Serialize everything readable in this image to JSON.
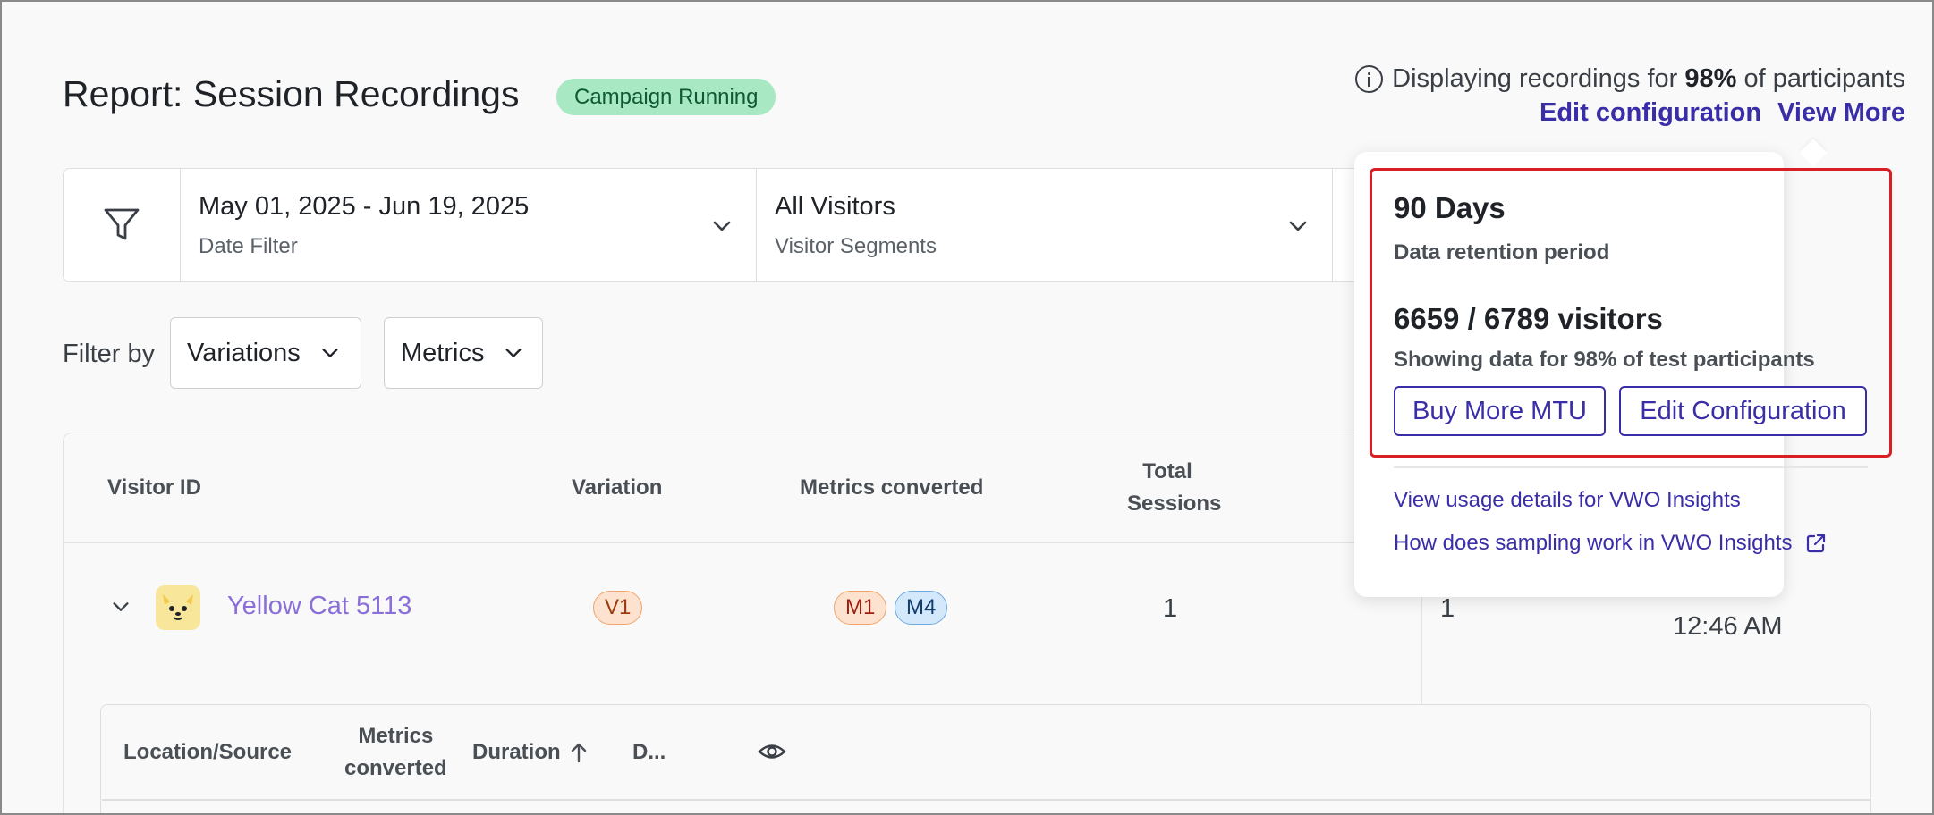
{
  "header": {
    "title": "Report: Session Recordings",
    "status_badge": "Campaign Running",
    "info_prefix": "Displaying recordings for ",
    "info_percent": "98%",
    "info_suffix": " of participants",
    "edit_link": "Edit configuration",
    "view_more_link": "View More"
  },
  "filters": {
    "date": {
      "value": "May 01, 2025 - Jun 19, 2025",
      "label": "Date Filter"
    },
    "segment": {
      "value": "All Visitors",
      "label": "Visitor Segments"
    }
  },
  "filter_by": {
    "label": "Filter by",
    "variations": "Variations",
    "metrics": "Metrics"
  },
  "table": {
    "columns": {
      "visitor_id": "Visitor ID",
      "variation": "Variation",
      "metrics_converted": "Metrics converted",
      "total_sessions_1": "Total",
      "total_sessions_2": "Sessions"
    },
    "rows": [
      {
        "visitor": "Yellow Cat 5113",
        "variation": "V1",
        "metrics": [
          "M1",
          "M4"
        ],
        "total_sessions": "1",
        "col5": "1",
        "time": "12:46 AM"
      }
    ],
    "subtable": {
      "location": "Location/Source",
      "metrics_1": "Metrics",
      "metrics_2": "converted",
      "duration": "Duration",
      "d": "D..."
    }
  },
  "popover": {
    "retention_value": "90 Days",
    "retention_label": "Data retention period",
    "visitors_value": "6659 / 6789 visitors",
    "visitors_label": "Showing data for 98% of test participants",
    "buy_button": "Buy More MTU",
    "edit_button": "Edit Configuration",
    "link_usage": "View usage details for VWO Insights",
    "link_sampling": "How does sampling work in VWO Insights"
  },
  "colors": {
    "accent": "#3a2ea8",
    "badge_bg": "#a8e9c4",
    "highlight": "#d81f26",
    "visitor_link": "#8a6fd8"
  },
  "icons": [
    "info-icon",
    "filter-icon",
    "chevron-down-icon",
    "cat-avatar-icon",
    "arrow-up-icon",
    "eye-icon",
    "external-link-icon"
  ]
}
